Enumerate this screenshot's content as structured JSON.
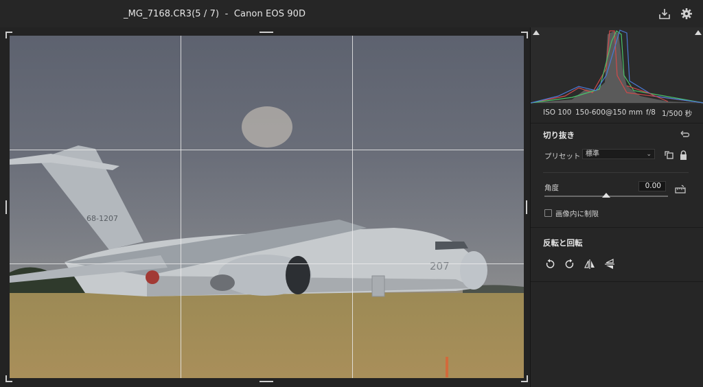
{
  "window": {
    "title": "_MG_7168.CR3(5 / 7)  -  Canon EOS 90D",
    "icons": [
      "download-icon",
      "gear-icon"
    ]
  },
  "photo": {
    "aircraft_tail_code": "68-1207",
    "aircraft_nose_number": "207"
  },
  "histogram": {
    "meta": {
      "iso": "ISO 100",
      "lens": "150-600@150 mm",
      "aperture": "f/8",
      "shutter": "1/500 秒"
    }
  },
  "crop": {
    "title": "切り抜き",
    "preset_label": "プリセット",
    "preset_value": "標準",
    "angle_label": "角度",
    "angle_value": "0.00",
    "constrain_label": "画像内に制限",
    "constrain_checked": false
  },
  "transform": {
    "title": "反転と回転"
  }
}
